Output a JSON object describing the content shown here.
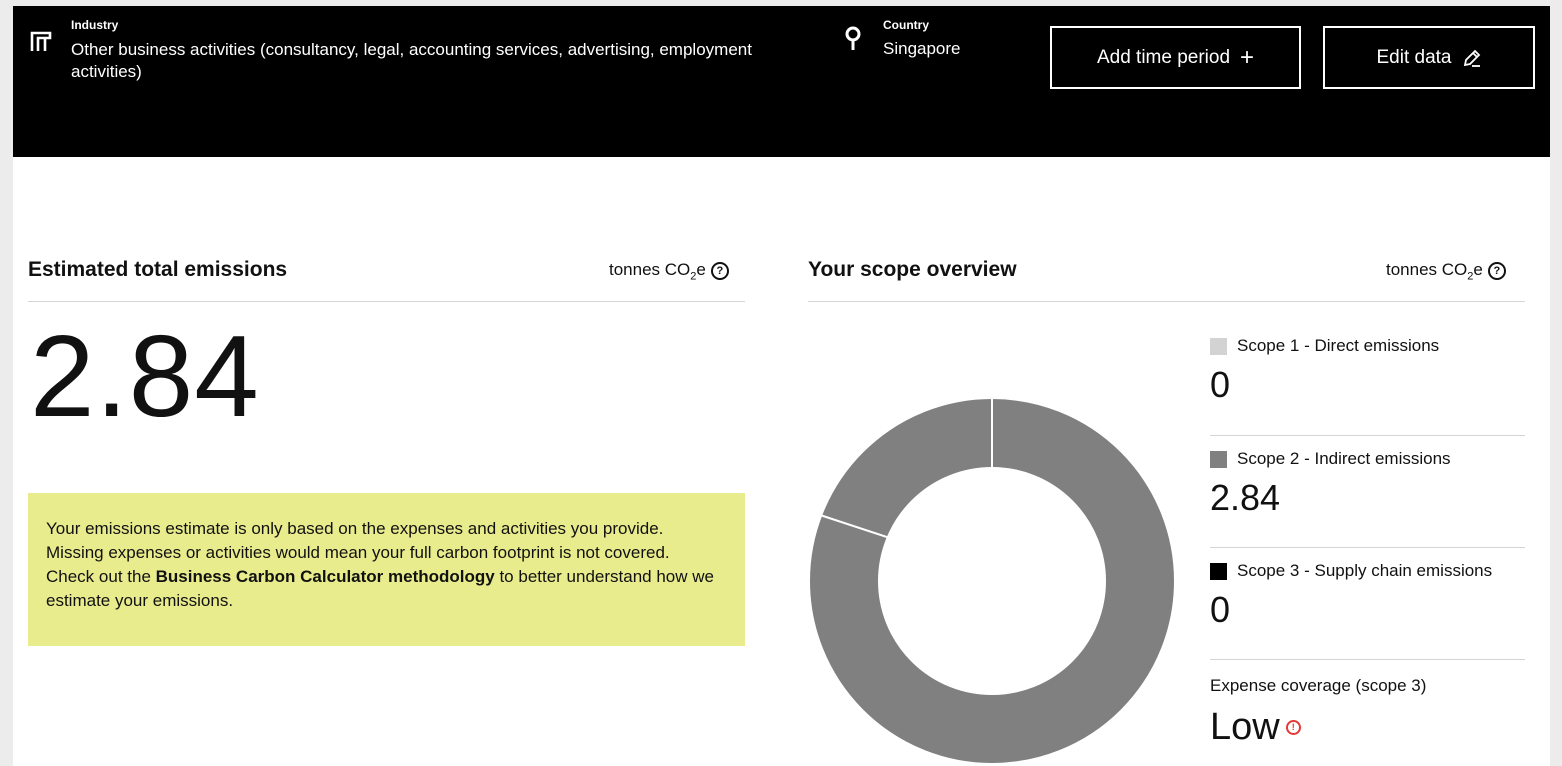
{
  "header": {
    "industry_label": "Industry",
    "industry_value": "Other business activities (consultancy, legal, accounting services, advertising, employment activities)",
    "country_label": "Country",
    "country_value": "Singapore",
    "add_time_period_label": "Add time period",
    "edit_data_label": "Edit data"
  },
  "emissions": {
    "title": "Estimated total emissions",
    "unit_prefix": "tonnes CO",
    "unit_sub": "2",
    "unit_suffix": "e",
    "total": "2.84",
    "note_part1": "Your emissions estimate is only based on the expenses and activities you provide. Missing expenses or activities would mean your full carbon footprint is not covered. Check out the ",
    "note_link": "Business Carbon Calculator methodology",
    "note_part2": " to better understand how we estimate your emissions."
  },
  "scope": {
    "title": "Your scope overview",
    "unit_prefix": "tonnes CO",
    "unit_sub": "2",
    "unit_suffix": "e",
    "items": [
      {
        "label": "Scope 1 - Direct emissions",
        "value": "0",
        "color": "#d3d3d3"
      },
      {
        "label": "Scope 2 - Indirect emissions",
        "value": "2.84",
        "color": "#808080"
      },
      {
        "label": "Scope 3 - Supply chain emissions",
        "value": "0",
        "color": "#000000"
      }
    ],
    "coverage_label": "Expense coverage (scope 3)",
    "coverage_value": "Low"
  },
  "icons": {
    "industry": "building-icon",
    "country": "location-pin-icon",
    "add": "plus-icon",
    "edit": "pencil-icon",
    "help": "question-circle-icon",
    "warning": "exclamation-circle-icon"
  }
}
